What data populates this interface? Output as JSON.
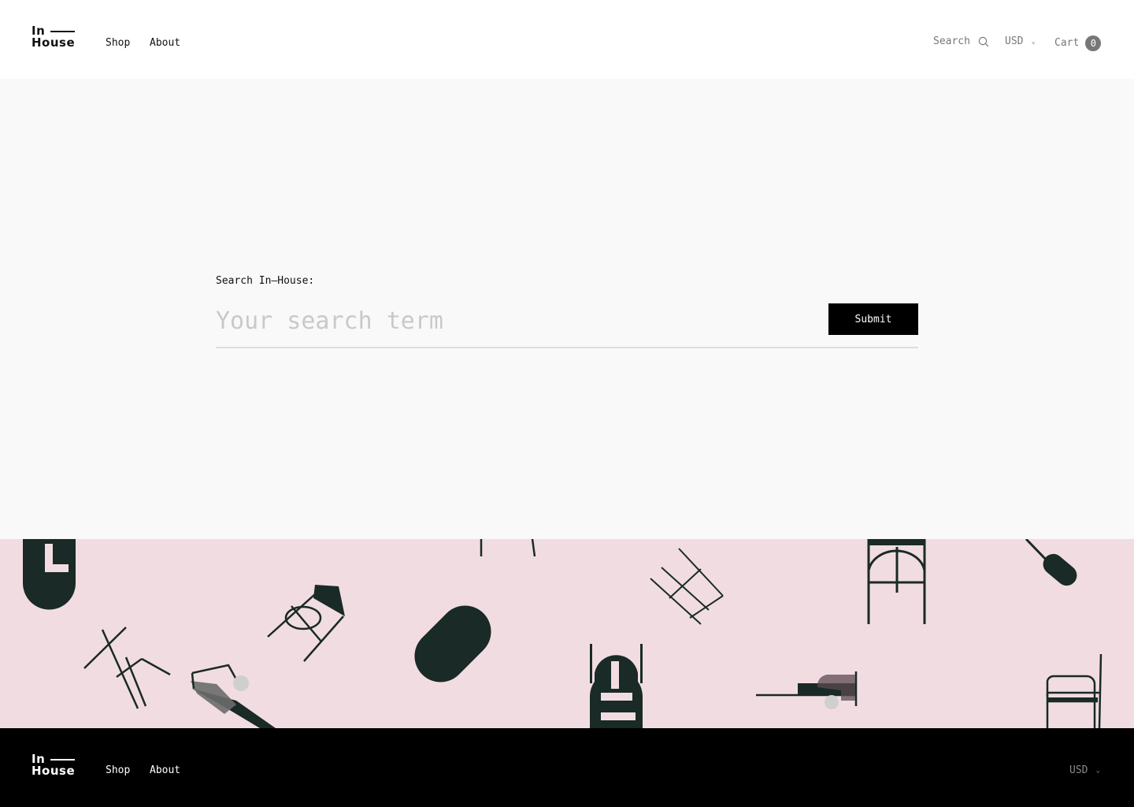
{
  "header": {
    "logo": {
      "line1": "In",
      "line2": "House"
    },
    "nav": [
      {
        "label": "Shop"
      },
      {
        "label": "About"
      }
    ],
    "search_label": "Search",
    "currency": "USD",
    "cart_label": "Cart",
    "cart_count": "0"
  },
  "search": {
    "label": "Search In—House:",
    "placeholder": "Your search term",
    "submit_label": "Submit"
  },
  "band": {
    "background": "#f1dde1",
    "illustration": "scattered-furniture-illustrations"
  },
  "footer": {
    "logo": {
      "line1": "In",
      "line2": "House"
    },
    "nav": [
      {
        "label": "Shop"
      },
      {
        "label": "About"
      }
    ],
    "currency": "USD"
  },
  "colors": {
    "accent": "#000000",
    "furniture_dark": "#1a2a26",
    "cart_badge": "#777777"
  }
}
